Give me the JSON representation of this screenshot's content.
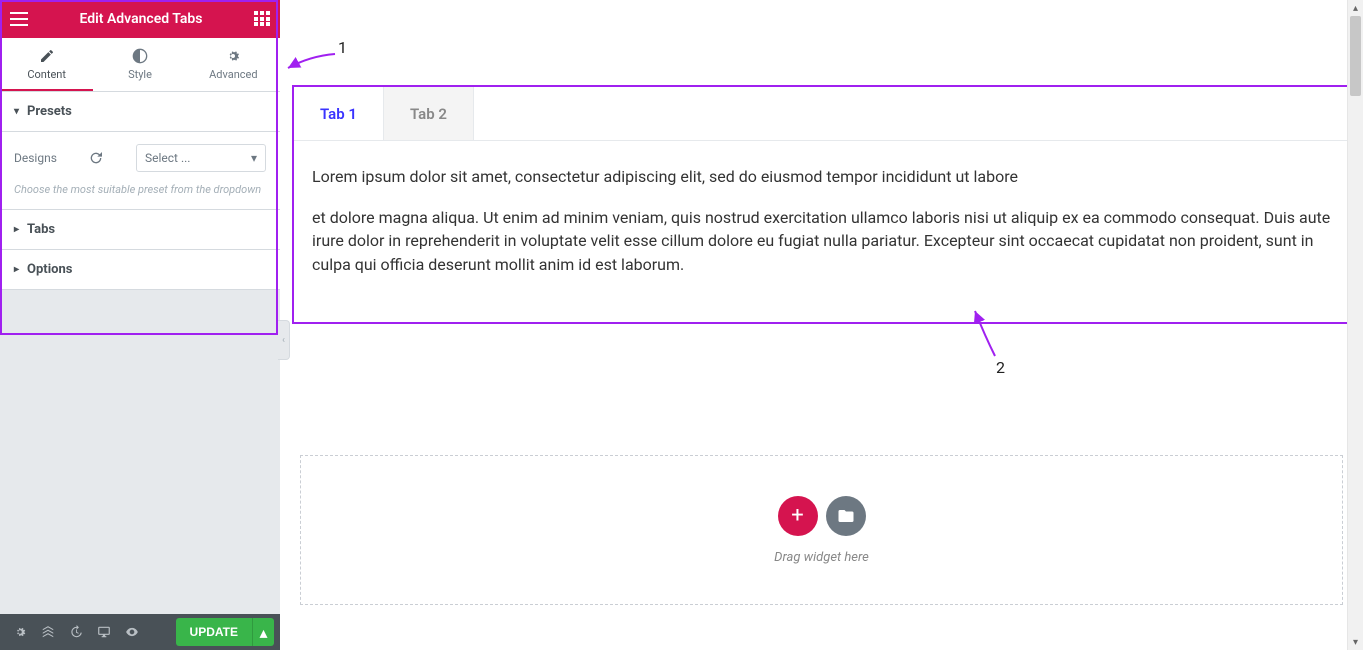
{
  "panel": {
    "title": "Edit Advanced Tabs",
    "tabs": {
      "content": "Content",
      "style": "Style",
      "advanced": "Advanced"
    },
    "sections": {
      "presets": "Presets",
      "tabs": "Tabs",
      "options": "Options"
    },
    "presets": {
      "label": "Designs",
      "select_placeholder": "Select ...",
      "hint": "Choose the most suitable preset from the dropdown"
    },
    "footer": {
      "update": "UPDATE"
    }
  },
  "annotations": {
    "one": "1",
    "two": "2"
  },
  "widget": {
    "tabs": [
      {
        "label": "Tab 1"
      },
      {
        "label": "Tab 2"
      }
    ],
    "content": {
      "p1": "Lorem ipsum dolor sit amet, consectetur adipiscing elit, sed do eiusmod tempor incididunt ut labore",
      "p2": "et dolore magna aliqua. Ut enim ad minim veniam, quis nostrud exercitation ullamco laboris nisi ut aliquip ex ea commodo consequat. Duis aute irure dolor in reprehenderit in voluptate velit esse cillum dolore eu fugiat nulla pariatur. Excepteur sint occaecat cupidatat non proident, sunt in culpa qui officia deserunt mollit anim id est laborum."
    }
  },
  "dropzone": {
    "text": "Drag widget here"
  }
}
